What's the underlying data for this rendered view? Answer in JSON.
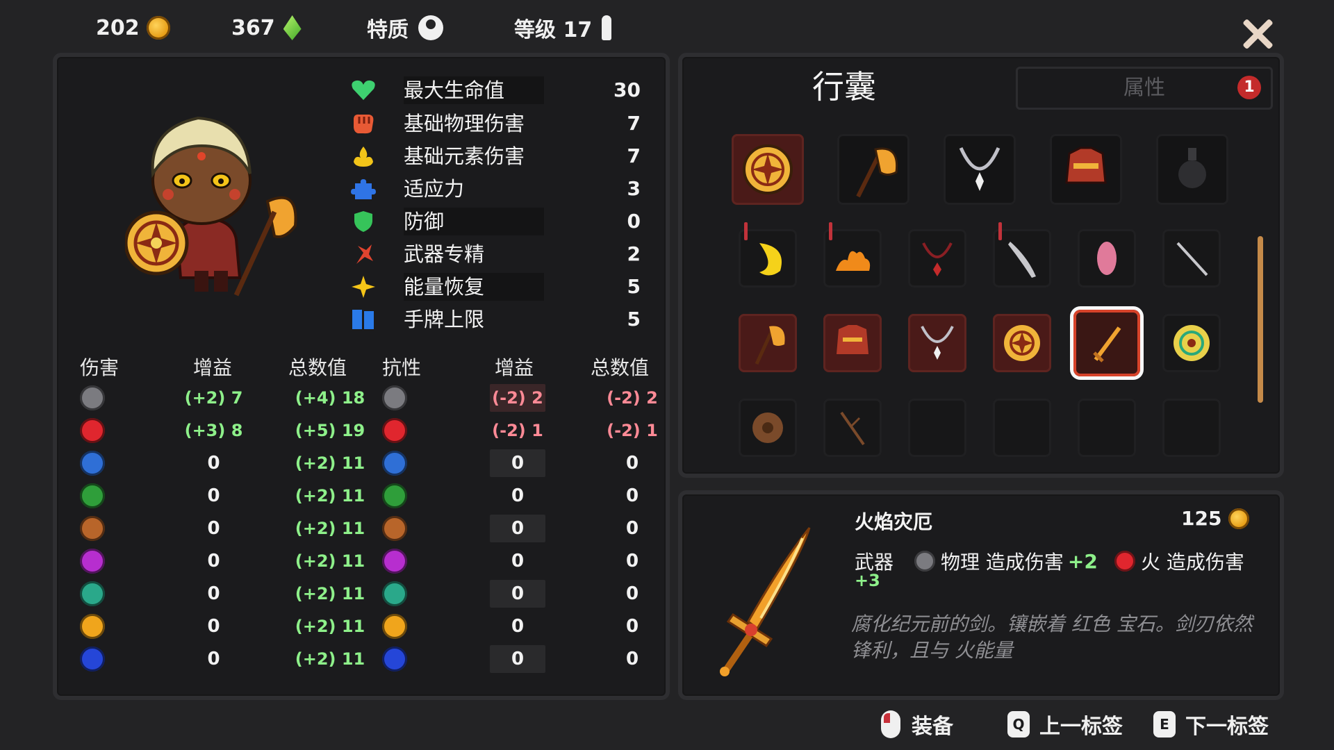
{
  "topbar": {
    "gold": "202",
    "gems": "367",
    "trait_label": "特质",
    "level_label": "等级 17"
  },
  "stats": [
    {
      "label": "最大生命值",
      "value": "30",
      "icon": "heart-icon",
      "color": "#3ed070"
    },
    {
      "label": "基础物理伤害",
      "value": "7",
      "icon": "fist-icon",
      "color": "#e85a35"
    },
    {
      "label": "基础元素伤害",
      "value": "7",
      "icon": "elements-icon",
      "color": "#f2c419"
    },
    {
      "label": "适应力",
      "value": "3",
      "icon": "puzzle-icon",
      "color": "#2f74e6"
    },
    {
      "label": "防御",
      "value": "0",
      "icon": "shield-icon",
      "color": "#36c45a"
    },
    {
      "label": "武器专精",
      "value": "2",
      "icon": "weapon-mastery-icon",
      "color": "#e0442f"
    },
    {
      "label": "能量恢复",
      "value": "5",
      "icon": "star-icon",
      "color": "#f5c518"
    },
    {
      "label": "手牌上限",
      "value": "5",
      "icon": "cards-icon",
      "color": "#2a7ae8"
    }
  ],
  "table": {
    "headers": [
      "伤害",
      "增益",
      "总数值",
      "抗性",
      "增益",
      "总数值"
    ],
    "rows": [
      {
        "element": "physical",
        "color": "#7b7b80",
        "dmg_bonus": "(+2) 7",
        "dmg_total": "(+4) 18",
        "res_bonus": "(-2) 2",
        "res_total": "(-2) 2"
      },
      {
        "element": "fire",
        "color": "#e0262e",
        "dmg_bonus": "(+3) 8",
        "dmg_total": "(+5) 19",
        "res_bonus": "(-2) 1",
        "res_total": "(-2) 1"
      },
      {
        "element": "ice",
        "color": "#2f6fd6",
        "dmg_bonus": "0",
        "dmg_total": "(+2) 11",
        "res_bonus": "0",
        "res_total": "0"
      },
      {
        "element": "poison",
        "color": "#2f9e3a",
        "dmg_bonus": "0",
        "dmg_total": "(+2) 11",
        "res_bonus": "0",
        "res_total": "0"
      },
      {
        "element": "earth",
        "color": "#b8652a",
        "dmg_bonus": "0",
        "dmg_total": "(+2) 11",
        "res_bonus": "0",
        "res_total": "0"
      },
      {
        "element": "arcane",
        "color": "#b72ecf",
        "dmg_bonus": "0",
        "dmg_total": "(+2) 11",
        "res_bonus": "0",
        "res_total": "0"
      },
      {
        "element": "wind",
        "color": "#2aa88a",
        "dmg_bonus": "0",
        "dmg_total": "(+2) 11",
        "res_bonus": "0",
        "res_total": "0"
      },
      {
        "element": "lightning",
        "color": "#f0a51c",
        "dmg_bonus": "0",
        "dmg_total": "(+2) 11",
        "res_bonus": "0",
        "res_total": "0"
      },
      {
        "element": "water",
        "color": "#2546d8",
        "dmg_bonus": "0",
        "dmg_total": "(+2) 11",
        "res_bonus": "0",
        "res_total": "0"
      }
    ]
  },
  "inventory": {
    "tab_active": "行囊",
    "tab_inactive": "属性",
    "tab_badge": "1",
    "equipped": [
      "shield-icon",
      "axe-icon",
      "necklace-icon",
      "armor-icon",
      "potion-icon"
    ],
    "slots": [
      "crescent-icon",
      "fire-pile-icon",
      "amulet-icon",
      "blade-icon",
      "pink-charm-icon",
      "dagger-icon",
      "axe-icon",
      "armor-icon",
      "necklace-icon",
      "shield-icon",
      "flame-sword-icon",
      "golden-shield-icon",
      "buckler-icon",
      "stick-icon",
      "",
      "",
      "",
      ""
    ]
  },
  "item": {
    "name": "火焰灾厄",
    "price": "125",
    "type": "武器",
    "effect1_label": "物理 造成伤害",
    "effect1_bonus": "+2",
    "effect2_label": "火 造成伤害",
    "effect2_bonus": "+3",
    "description": "腐化纪元前的剑。镶嵌着 红色 宝石。剑刃依然锋利，且与 火能量"
  },
  "footer": {
    "equip_label": "装备",
    "prev_key": "Q",
    "prev_label": "上一标签",
    "next_key": "E",
    "next_label": "下一标签"
  }
}
